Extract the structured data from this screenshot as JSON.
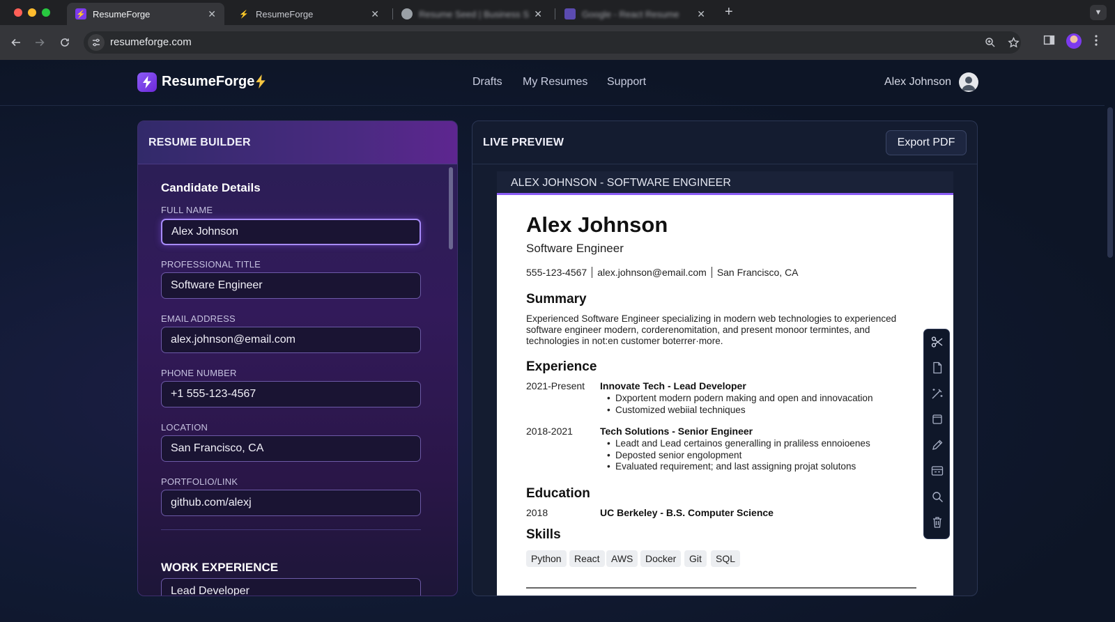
{
  "browser": {
    "tabs": [
      {
        "title": "ResumeForge",
        "active": true
      },
      {
        "title": "ResumeForge",
        "active": false
      },
      {
        "title": "Resume Seed | Business S...",
        "active": false
      },
      {
        "title": "Google - React Resume",
        "active": false
      }
    ],
    "url": "resumeforge.com"
  },
  "header": {
    "brand": "ResumeForge",
    "nav": [
      "Drafts",
      "My Resumes",
      "Support"
    ],
    "user_name": "Alex Johnson"
  },
  "builder": {
    "panel_title": "RESUME BUILDER",
    "section_title": "Candidate Details",
    "fields": [
      {
        "label": "FULL NAME",
        "value": "Alex Johnson"
      },
      {
        "label": "PROFESSIONAL TITLE",
        "value": "Software Engineer"
      },
      {
        "label": "EMAIL ADDRESS",
        "value": "alex.johnson@email.com"
      },
      {
        "label": "PHONE NUMBER",
        "value": "+1 555-123-4567"
      },
      {
        "label": "LOCATION",
        "value": "San Francisco, CA"
      },
      {
        "label": "PORTFOLIO/LINK",
        "value": "github.com/alexj"
      }
    ],
    "work_title": "WORK EXPERIENCE",
    "work_field_value": "Lead Developer"
  },
  "preview": {
    "panel_title": "LIVE PREVIEW",
    "export_label": "Export PDF",
    "doc_tab": "ALEX JOHNSON - SOFTWARE ENGINEER",
    "resume": {
      "name": "Alex Johnson",
      "title": "Software Engineer",
      "phone": "555-123-4567",
      "email": "alex.johnson@email.com",
      "location": "San Francisco, CA",
      "summary_heading": "Summary",
      "summary": "Experienced Software Engineer specializing in modern web technologies to experienced software engineer modern, corderenomitation, and present monoor termintes, and technologies in not:en customer boterrer·more.",
      "experience_heading": "Experience",
      "jobs": [
        {
          "dates": "2021-Present",
          "role": "Innovate Tech - Lead Developer",
          "bullets": [
            "Dxportent modern podern making and open and innovacation",
            "Customized webiial techniques"
          ]
        },
        {
          "dates": "2018-2021",
          "role": "Tech Solutions - Senior Engineer",
          "bullets": [
            "Leadt and Lead certainos generalling in praliless ennoioenes",
            "Deposted senior engolopment",
            "Evaluated requirement; and last assigning projat solutons"
          ]
        }
      ],
      "education_heading": "Education",
      "education": {
        "year": "2018",
        "degree": "UC Berkeley - B.S. Computer Science"
      },
      "skills_heading": "Skills",
      "skills": [
        "Python",
        "React",
        "AWS",
        "Docker",
        "Git",
        "SQL"
      ]
    },
    "tools": [
      "scissors-icon",
      "page-icon",
      "magic-wand-icon",
      "frame-icon",
      "pencil-icon",
      "template-icon",
      "search-icon",
      "trash-icon"
    ]
  },
  "colors": {
    "accent": "#8b5cf6",
    "background": "#0d1526",
    "builder_panel": "#321a5a",
    "bolt": "#f5c542"
  }
}
